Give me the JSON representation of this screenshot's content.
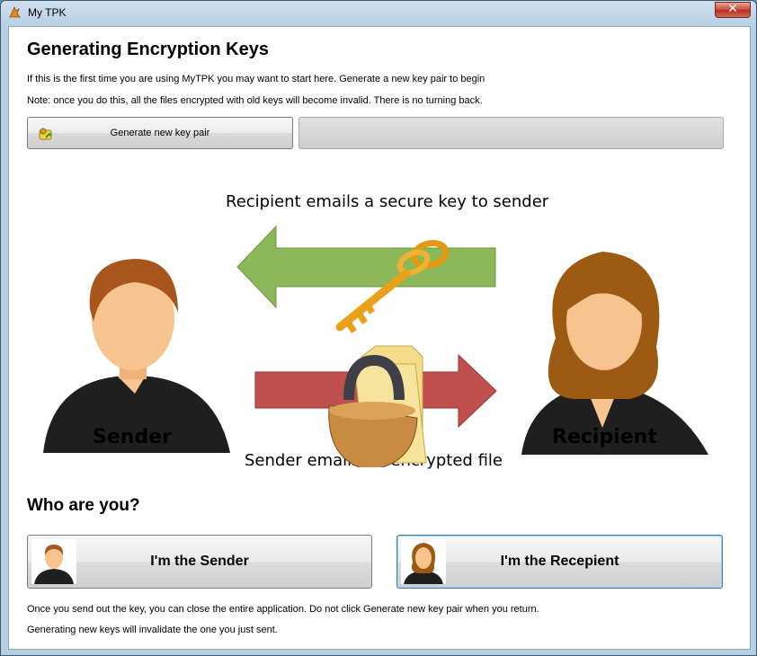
{
  "window": {
    "title": "My TPK",
    "close_glyph": "✕"
  },
  "heading": "Generating Encryption Keys",
  "intro": [
    "If this is the first time you are using MyTPK you may want to start here. Generate a new key pair to begin",
    "Note: once you do this, all the files encrypted with old keys will become invalid. There is no turning back."
  ],
  "generate_button": {
    "label": "Generate new key pair",
    "icon": "key-pair-icon"
  },
  "progress": {
    "value_percent": 0
  },
  "diagram": {
    "top_caption": "Recipient emails a secure key  to sender",
    "bottom_caption": "Sender emails an encrypted file",
    "sender_label": "Sender",
    "recipient_label": "Recipient",
    "colors": {
      "green_arrow": "#8db85a",
      "red_arrow": "#c0504d",
      "skin": "#f7c38f",
      "male_hair": "#a8561c",
      "female_hair": "#9c5a12",
      "shirt": "#1f1f1f",
      "gold": "#f0a820"
    }
  },
  "who_heading": "Who are you?",
  "sender_button": {
    "label": "I'm the Sender"
  },
  "recipient_button": {
    "label": "I'm the Recepient"
  },
  "footer": [
    "Once you send out the key, you can close the entire application. Do not click Generate new key pair when you return.",
    "Generating new keys will invalidate the one you just sent."
  ]
}
